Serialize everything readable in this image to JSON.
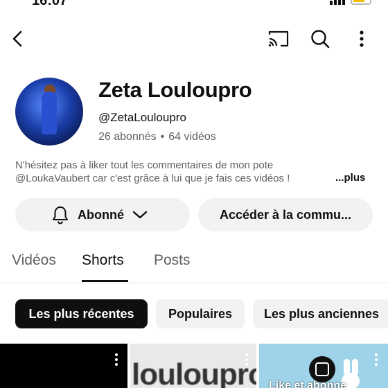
{
  "status": {
    "time": "16:07"
  },
  "header": {
    "back_icon": "chevron-left-icon",
    "cast_icon": "cast-icon",
    "search_icon": "search-icon",
    "more_icon": "more-vertical-icon"
  },
  "channel": {
    "name": "Zeta Louloupro",
    "handle": "@ZetaLouloupro",
    "subscribers": "26 abonnés",
    "separator": "•",
    "videos_count": "64 vidéos",
    "description_line1": "N'hésitez pas à liker tout les commentaires de mon pote",
    "description_line2": "@LoukaVaubert car c'est grâce à lui que je fais ces vidéos !",
    "more_label": "...plus"
  },
  "actions": {
    "subscribed_label": "Abonné",
    "community_label": "Accéder à la commu..."
  },
  "tabs": [
    {
      "label": "Vidéos",
      "active": false
    },
    {
      "label": "Shorts",
      "active": true
    },
    {
      "label": "Posts",
      "active": false
    }
  ],
  "filters": [
    {
      "label": "Les plus récentes",
      "selected": true
    },
    {
      "label": "Populaires",
      "selected": false
    },
    {
      "label": "Les plus anciennes",
      "selected": false
    }
  ],
  "thumbnails": [
    {
      "text": ""
    },
    {
      "text": "louloupro"
    },
    {
      "text": "Like et abonne"
    }
  ],
  "colors": {
    "text_primary": "#0f0f0f",
    "text_secondary": "#606060",
    "chip_bg": "#f2f2f2",
    "chip_selected_bg": "#0f0f0f"
  }
}
